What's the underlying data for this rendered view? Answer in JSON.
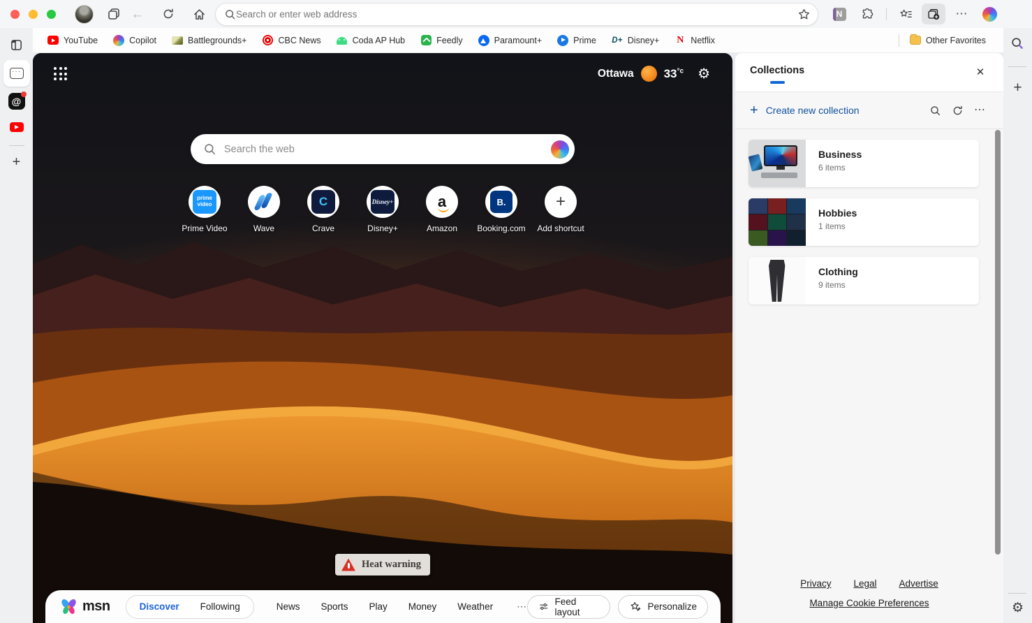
{
  "colors": {
    "edge_accent": "#1267d2",
    "link_blue": "#10509e",
    "discover_blue": "#1d63d8",
    "weather_sun_orange": "#f07d12",
    "heat_warning_red": "#d93025",
    "youtube_red": "#ff0000",
    "netflix_red": "#e50914"
  },
  "chrome": {
    "address_placeholder": "Search or enter web address"
  },
  "favorites": {
    "items": [
      {
        "label": "YouTube"
      },
      {
        "label": "Copilot"
      },
      {
        "label": "Battlegrounds+"
      },
      {
        "label": "CBC News"
      },
      {
        "label": "Coda AP Hub"
      },
      {
        "label": "Feedly"
      },
      {
        "label": "Paramount+"
      },
      {
        "label": "Prime"
      },
      {
        "label": "Disney+"
      },
      {
        "label": "Netflix"
      }
    ],
    "other_label": "Other Favorites"
  },
  "newtab": {
    "weather": {
      "city": "Ottawa",
      "temp": "33",
      "unit": "°c"
    },
    "search_placeholder": "Search the web",
    "shortcuts": [
      {
        "label": "Prime Video"
      },
      {
        "label": "Wave"
      },
      {
        "label": "Crave"
      },
      {
        "label": "Disney+"
      },
      {
        "label": "Amazon"
      },
      {
        "label": "Booking.com"
      },
      {
        "label": "Add shortcut"
      }
    ],
    "heat_warning": "Heat warning",
    "nav": {
      "brand": "msn",
      "tabs": [
        {
          "label": "Discover"
        },
        {
          "label": "Following"
        }
      ],
      "links": [
        "News",
        "Sports",
        "Play",
        "Money",
        "Weather"
      ],
      "feed_layout": "Feed layout",
      "personalize": "Personalize"
    }
  },
  "collections": {
    "title": "Collections",
    "create_label": "Create new collection",
    "items": [
      {
        "name": "Business",
        "count": "6 items"
      },
      {
        "name": "Hobbies",
        "count": "1 items"
      },
      {
        "name": "Clothing",
        "count": "9 items"
      }
    ],
    "footer_links": [
      "Privacy",
      "Legal",
      "Advertise"
    ],
    "cookie_label": "Manage Cookie Preferences"
  },
  "glyphs": {
    "plus": "+",
    "close": "✕",
    "more": "⋯",
    "back": "←",
    "at": "@",
    "gear": "⚙",
    "card_dots": "···",
    "onenote": "N",
    "netflix": "N",
    "disney_compact": "D+",
    "crave": "C",
    "amazon": "a",
    "booking": "B.",
    "prime_video": "prime video",
    "disney_script": "Disney+"
  }
}
